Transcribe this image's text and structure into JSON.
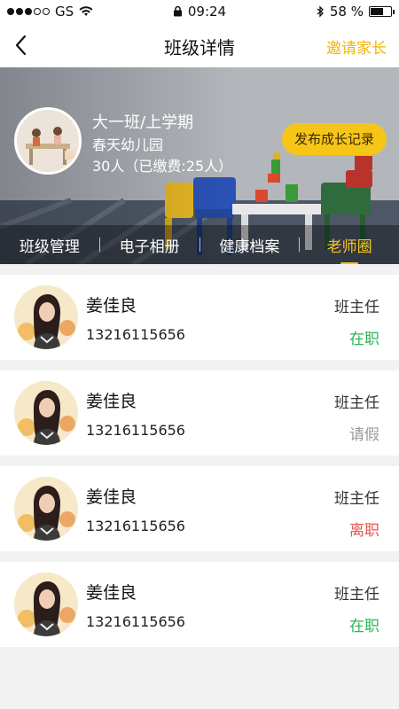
{
  "status_bar": {
    "carrier": "GS",
    "time": "09:24",
    "battery": "58 %"
  },
  "nav": {
    "title": "班级详情",
    "invite_label": "邀请家长"
  },
  "banner": {
    "class_name": "大一班/上学期",
    "school": "春天幼儿园",
    "count": "30人（已缴费:25人）",
    "publish_label": "发布成长记录"
  },
  "tabs": [
    {
      "label": "班级管理",
      "active": false
    },
    {
      "label": "电子相册",
      "active": false
    },
    {
      "label": "健康档案",
      "active": false
    },
    {
      "label": "老师圈",
      "active": true
    }
  ],
  "teachers": [
    {
      "name": "姜佳良",
      "phone": "13216115656",
      "role": "班主任",
      "status": "在职",
      "status_color": "#2fb457"
    },
    {
      "name": "姜佳良",
      "phone": "13216115656",
      "role": "班主任",
      "status": "请假",
      "status_color": "#9a9a9a"
    },
    {
      "name": "姜佳良",
      "phone": "13216115656",
      "role": "班主任",
      "status": "离职",
      "status_color": "#e2574c"
    },
    {
      "name": "姜佳良",
      "phone": "13216115656",
      "role": "班主任",
      "status": "在职",
      "status_color": "#2fb457"
    }
  ]
}
